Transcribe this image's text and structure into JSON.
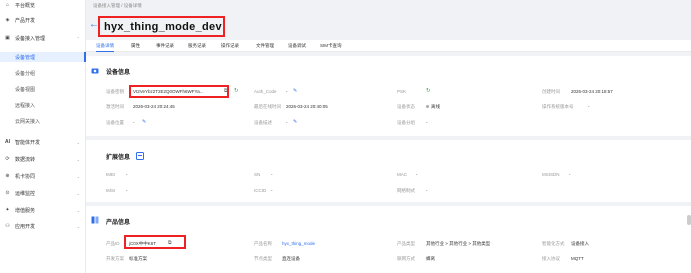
{
  "sidebar": {
    "items": [
      {
        "label": "平台概览",
        "icon": "home-icon",
        "arrow": ""
      },
      {
        "label": "产品开发",
        "icon": "cube-icon",
        "arrow": ""
      },
      {
        "label": "设备接入管理",
        "icon": "device-icon",
        "arrow": "⌃"
      },
      {
        "label": "智能体开发",
        "icon": "ai-icon",
        "arrow": "⌄"
      },
      {
        "label": "数据流转",
        "icon": "flow-icon",
        "arrow": "⌄"
      },
      {
        "label": "机卡协同",
        "icon": "sim-icon",
        "arrow": "⌄"
      },
      {
        "label": "运维监控",
        "icon": "monitor-icon",
        "arrow": "⌄"
      },
      {
        "label": "增值服务",
        "icon": "service-icon",
        "arrow": "⌄"
      },
      {
        "label": "应用开发",
        "icon": "app-icon",
        "arrow": "⌄"
      }
    ],
    "subitems": [
      "设备管理",
      "设备分组",
      "设备视图",
      "远程接入",
      "云网关接入"
    ]
  },
  "breadcrumb": "设备接入管理  /  设备详情",
  "title": "hyx_thing_mode_dev",
  "tabs": [
    "设备详情",
    "属性",
    "事件记录",
    "服务记录",
    "操作记录",
    "文件管理",
    "设备调试",
    "SIM卡查询"
  ],
  "device_info": {
    "title": "设备信息",
    "fields": [
      {
        "label": "设备密钥",
        "value": "Vt2VeYbz2T2E2Q0OWFh6WFYa..."
      },
      {
        "label": "Auth_Code",
        "value": "-"
      },
      {
        "label": "PSK",
        "value": ""
      },
      {
        "label": "创建时间",
        "value": "2026-03-24 20:18:57"
      },
      {
        "label": "激活时间",
        "value": "2026-03-24 20:24:45"
      },
      {
        "label": "最后在线时间",
        "value": "2026-03-24 20:40:05"
      },
      {
        "label": "设备状态",
        "value": "离线"
      },
      {
        "label": "操作系统版本号",
        "value": "-"
      },
      {
        "label": "设备位置",
        "value": "-"
      },
      {
        "label": "设备描述",
        "value": "-"
      },
      {
        "label": "设备分组",
        "value": "-"
      }
    ]
  },
  "ext_info": {
    "title": "扩展信息",
    "fields": [
      {
        "label": "IMEI",
        "value": "-"
      },
      {
        "label": "SN",
        "value": "-"
      },
      {
        "label": "MAC",
        "value": "-"
      },
      {
        "label": "MSISDN",
        "value": "-"
      },
      {
        "label": "IMSI",
        "value": "-"
      },
      {
        "label": "ICCID",
        "value": "-"
      },
      {
        "label": "网络制式",
        "value": "-"
      }
    ]
  },
  "product_info": {
    "title": "产品信息",
    "fields": [
      {
        "label": "产品ID",
        "value": "jC0X中中K6T"
      },
      {
        "label": "产品名称",
        "value": "hyx_thing_mode"
      },
      {
        "label": "产品类型",
        "value": "其他行业 > 其他行业 > 其他类型"
      },
      {
        "label": "智能化方式",
        "value": "设备接入"
      },
      {
        "label": "开发方案",
        "value": "标准方案"
      },
      {
        "label": "节点类型",
        "value": "直连设备"
      },
      {
        "label": "联网方式",
        "value": "蜂窝"
      },
      {
        "label": "接入协议",
        "value": "MQTT"
      }
    ]
  },
  "colors": {
    "accent": "#2f6fed",
    "highlight": "#e22222",
    "online_green": "#2f9d4e"
  }
}
